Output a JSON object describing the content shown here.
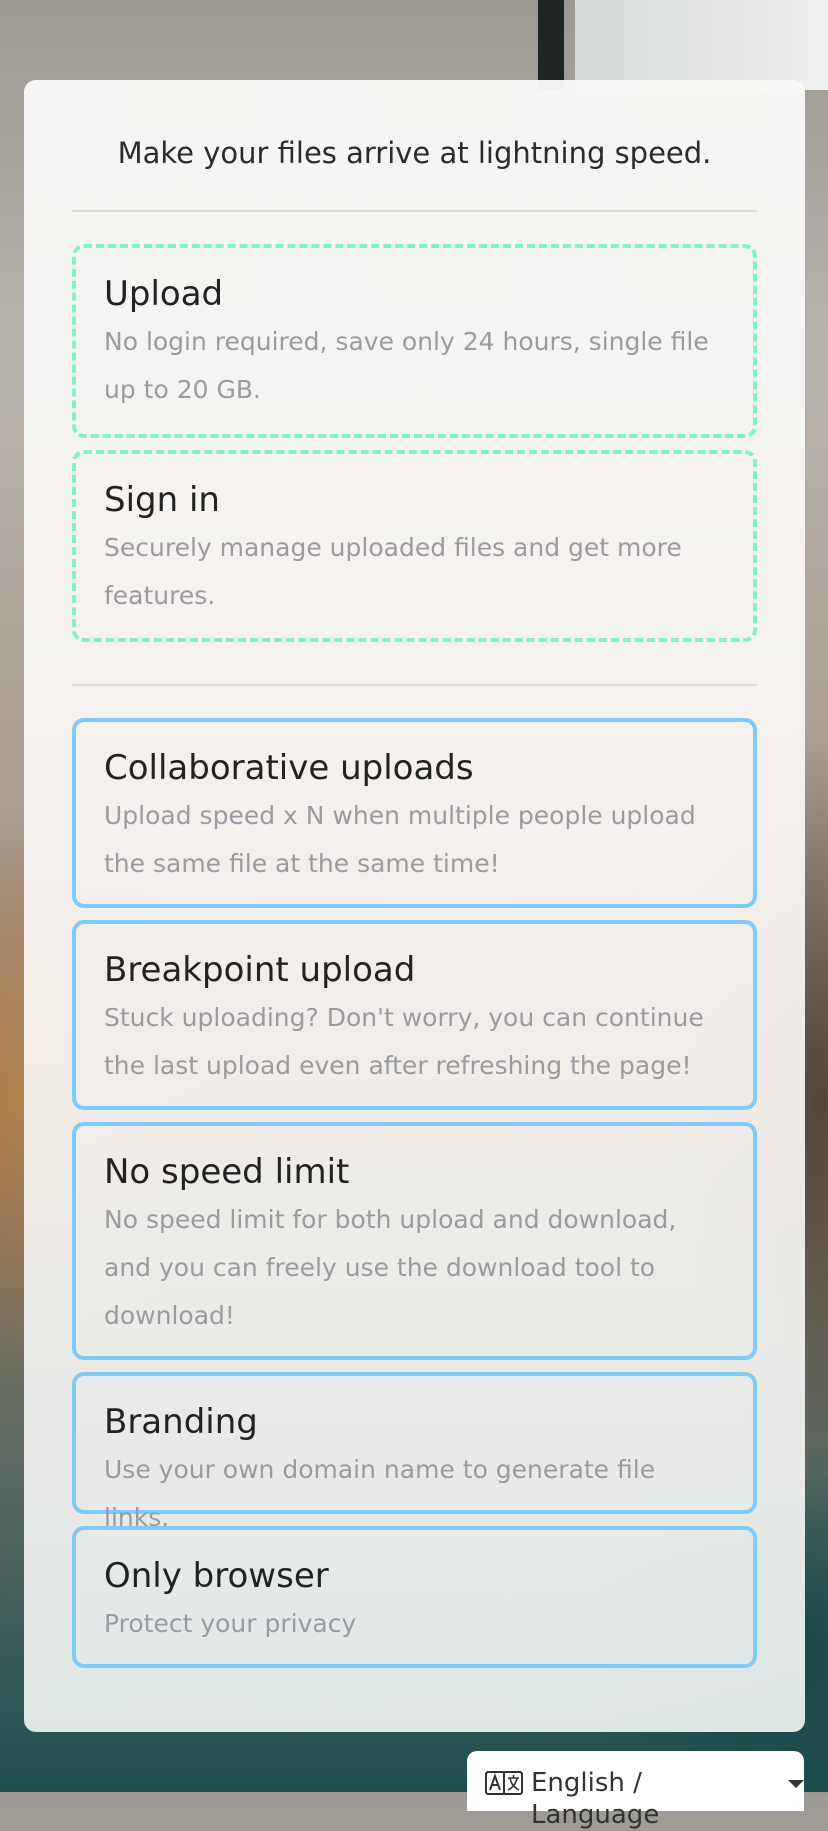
{
  "header": {
    "tagline": "Make your files arrive at lightning speed."
  },
  "actions": [
    {
      "title": "Upload",
      "description": "No login required, save only 24 hours, single file up to 20 GB."
    },
    {
      "title": "Sign in",
      "description": "Securely manage uploaded files and get more features."
    }
  ],
  "features": [
    {
      "title": "Collaborative uploads",
      "description": "Upload speed x N when multiple people upload the same file at the same time!"
    },
    {
      "title": "Breakpoint upload",
      "description": "Stuck uploading? Don't worry, you can continue the last upload even after refreshing the page!"
    },
    {
      "title": "No speed limit",
      "description": "No speed limit for both upload and download, and you can freely use the download tool to download!"
    },
    {
      "title": "Branding",
      "description": "Use your own domain name to generate file links."
    },
    {
      "title": "Only browser",
      "description": "Protect your privacy"
    }
  ],
  "language": {
    "label": "English / Language",
    "icon": "translate-icon"
  },
  "colors": {
    "dashed_border": "#7ff2c8",
    "solid_border": "#7ecbf7"
  }
}
